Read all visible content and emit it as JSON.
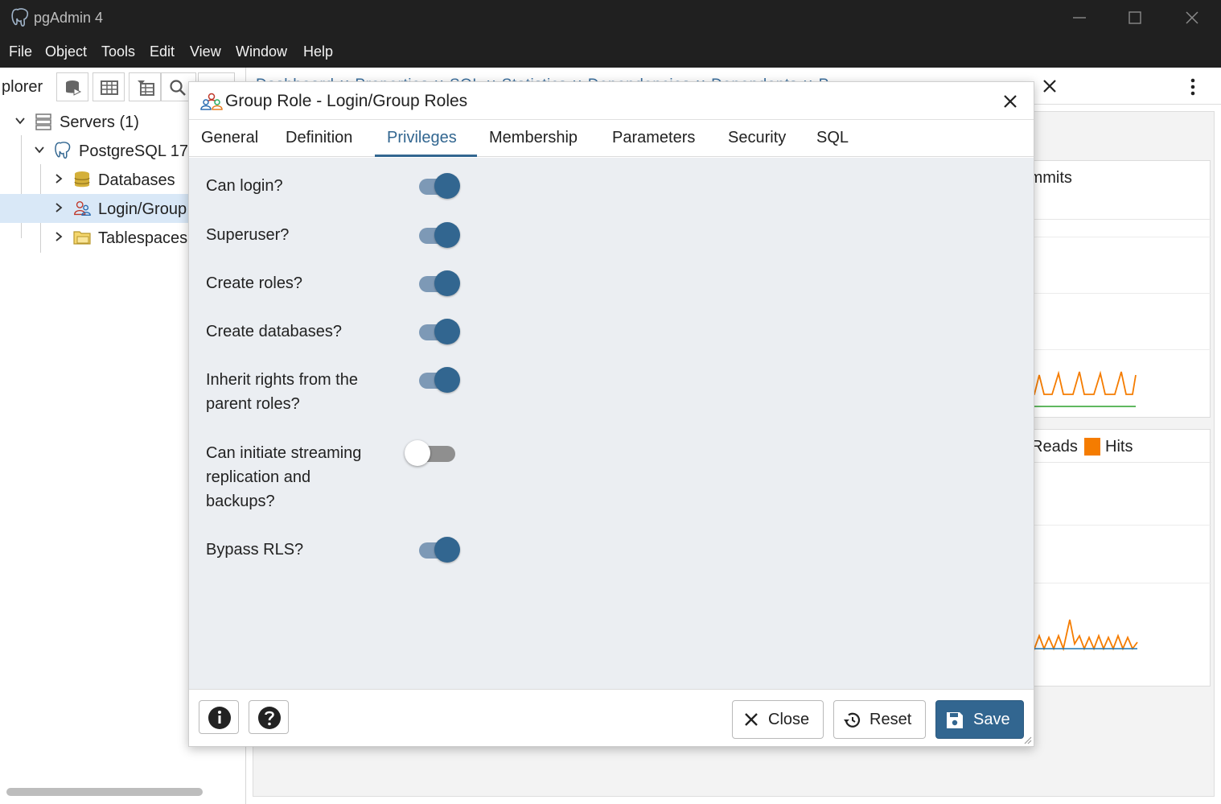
{
  "window": {
    "title": "pgAdmin 4"
  },
  "menu": [
    "File",
    "Object",
    "Tools",
    "Edit",
    "View",
    "Window",
    "Help"
  ],
  "explorer": {
    "tab_label": "plorer",
    "tree": [
      {
        "label": "Servers (1)",
        "level": 0,
        "expanded": true
      },
      {
        "label": "PostgreSQL 17",
        "level": 1,
        "expanded": true
      },
      {
        "label": "Databases",
        "level": 2,
        "expanded": false
      },
      {
        "label": "Login/Group",
        "level": 2,
        "expanded": false,
        "selected": true
      },
      {
        "label": "Tablespaces",
        "level": 2,
        "expanded": false
      }
    ]
  },
  "dashboard": {
    "tabs_text": "Dashboard ∨ Properties ∨ SQL ∨ Statistics ∨ Dependencies ∨ Dependents ∨ P",
    "legend_top": {
      "partial": "s",
      "items": [
        {
          "label": "Commits",
          "color": "#f57c00"
        }
      ]
    },
    "legend_bottom": {
      "items": [
        {
          "label": "Reads",
          "color": "#1f77b4"
        },
        {
          "label": "Hits",
          "color": "#f57c00"
        }
      ]
    }
  },
  "dialog": {
    "title": "Group Role - Login/Group Roles",
    "tabs": [
      "General",
      "Definition",
      "Privileges",
      "Membership",
      "Parameters",
      "Security",
      "SQL"
    ],
    "active_tab": "Privileges",
    "privileges": [
      {
        "label": "Can login?",
        "value": true
      },
      {
        "label": "Superuser?",
        "value": true
      },
      {
        "label": "Create roles?",
        "value": true
      },
      {
        "label": "Create databases?",
        "value": true
      },
      {
        "label": "Inherit rights from the parent roles?",
        "value": true
      },
      {
        "label": "Can initiate streaming replication and backups?",
        "value": false
      },
      {
        "label": "Bypass RLS?",
        "value": true
      }
    ],
    "footer": {
      "close_label": "Close",
      "reset_label": "Reset",
      "save_label": "Save"
    }
  },
  "colors": {
    "accent": "#326690",
    "switch_track_on": "#7d99b6",
    "orange": "#f57c00",
    "selected_row": "#d9e8f7"
  }
}
